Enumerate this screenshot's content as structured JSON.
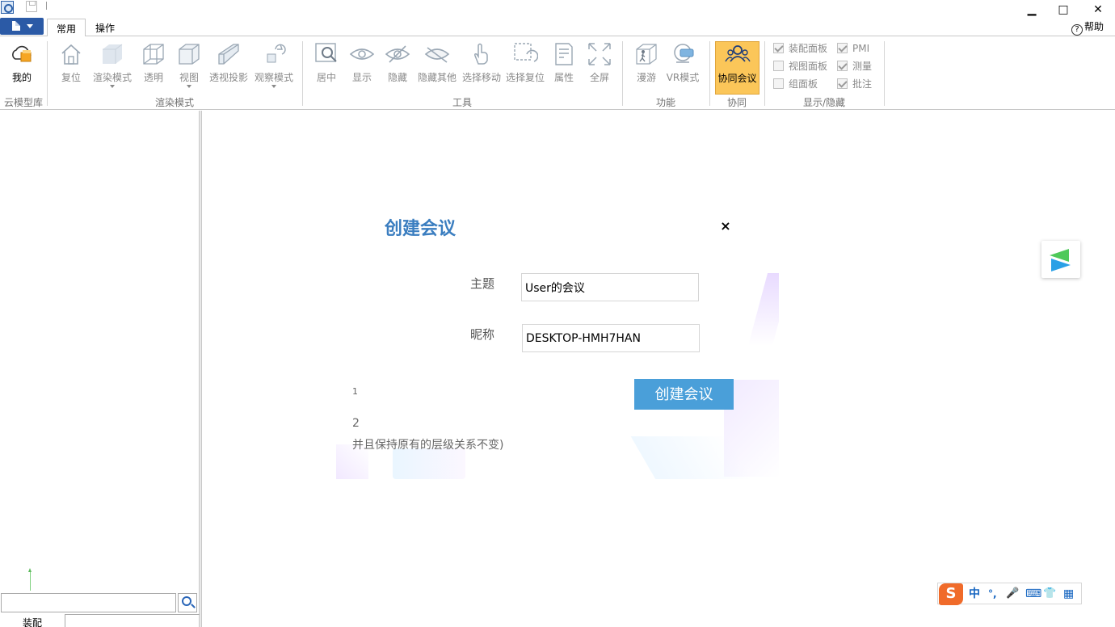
{
  "window": {
    "minimize": "▁",
    "maximize": "□",
    "close": "✕"
  },
  "tabs": [
    {
      "label": "常用"
    },
    {
      "label": "操作"
    }
  ],
  "help_label": "帮助",
  "ribbon": {
    "groups": {
      "cloud": "云模型库",
      "render": "渲染模式",
      "tools": "工具",
      "function": "功能",
      "collab": "协同",
      "show_hide": "显示/隐藏"
    },
    "buttons": {
      "mine": "我的",
      "reset": "复位",
      "render_mode": "渲染模式",
      "transparent": "透明",
      "view": "视图",
      "perspective": "透视投影",
      "observe_mode": "观察模式",
      "center": "居中",
      "show": "显示",
      "hide": "隐藏",
      "hide_others": "隐藏其他",
      "select_move": "选择移动",
      "select_reset": "选择复位",
      "properties": "属性",
      "fullscreen": "全屏",
      "walk": "漫游",
      "vr_mode": "VR模式",
      "collab_meeting": "协同会议"
    },
    "checks": {
      "assembly_panel": {
        "label": "装配面板",
        "checked": true
      },
      "view_panel": {
        "label": "视图面板",
        "checked": false
      },
      "group_panel": {
        "label": "组面板",
        "checked": false
      },
      "pmi": {
        "label": "PMI",
        "checked": true
      },
      "measure": {
        "label": "测量",
        "checked": true
      },
      "annotation": {
        "label": "批注",
        "checked": true
      }
    }
  },
  "left_panel": {
    "search_value": "",
    "bottom_tab": "装配"
  },
  "dialog": {
    "title": "创建会议",
    "close": "×",
    "subject_label": "主题",
    "subject_value": "User的会议",
    "nickname_label": "昵称",
    "nickname_value": "DESKTOP-HMH7HAN",
    "submit": "创建会议",
    "frag1": "1",
    "frag2": "2",
    "frag3": "并且保持原有的层级关系不变)"
  },
  "ime": {
    "logo": "S",
    "lang": "中",
    "punct": "°,",
    "mic": "🎤",
    "keyboard": "⌨",
    "skin": "👕",
    "apps": "▦"
  },
  "colors": {
    "accent": "#3b7ec0",
    "button": "#4a9fd9",
    "active_ribbon": "#fbc659",
    "file_button": "#2b5aa6"
  }
}
